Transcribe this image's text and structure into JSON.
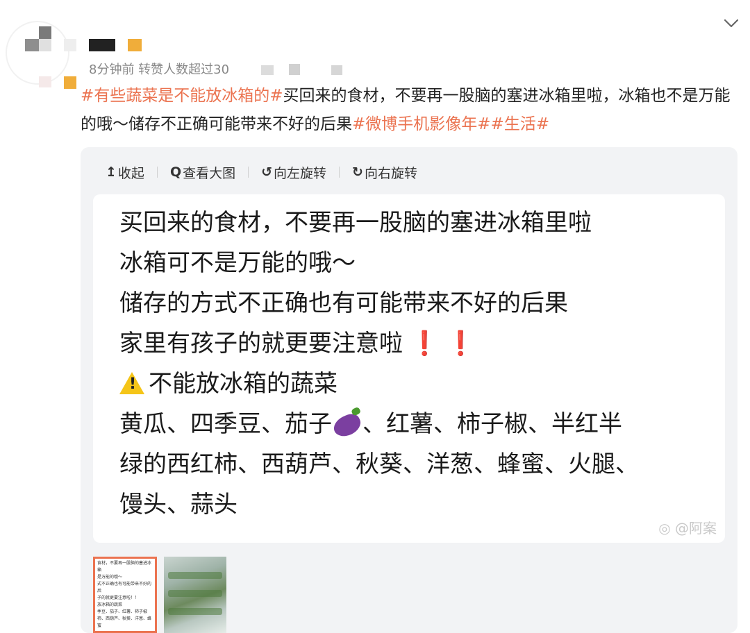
{
  "header": {
    "meta_text": "8分钟前 转赞人数超过30",
    "collapse_icon": "chevron-down-icon"
  },
  "post": {
    "tag1": "#有些蔬菜是不能放冰箱的#",
    "text": "买回来的食材，不要再一股脑的塞进冰箱里啦，冰箱也不是万能的哦～储存不正确可能带来不好的后果",
    "tag2": "#微博手机影像年#",
    "tag3": "#生活#",
    "tag_color": "#eb7350"
  },
  "toolbar": {
    "collapse": "收起",
    "view_large": "查看大图",
    "rotate_left": "向左旋转",
    "rotate_right": "向右旋转"
  },
  "image": {
    "line1": "买回来的食材，不要再一股脑的塞进冰箱里啦",
    "line2": "冰箱可不是万能的哦～",
    "line3": "储存的方式不正确也有可能带来不好的后果",
    "line4": "家里有孩子的就更要注意啦",
    "line5": "不能放冰箱的蔬菜",
    "line6a": "黄瓜、四季豆、茄子",
    "line6b": "、红薯、柿子椒、半红半",
    "line7": "绿的西红柿、西葫芦、秋葵、洋葱、蜂蜜、火腿、",
    "line8": "馒头、蒜头",
    "watermark": "@阿案"
  },
  "thumbnails": {
    "t1_lines": [
      "食材，不要再一股脑的塞进冰箱",
      "是万能的哦～",
      "式不正确也有可能带来不好的后",
      "子的就更要注意啦！！",
      "放冰箱的蔬菜",
      "季豆、茄子、红薯、柿子椒",
      "柿、西葫芦、秋葵、洋葱、蜂蜜"
    ]
  }
}
